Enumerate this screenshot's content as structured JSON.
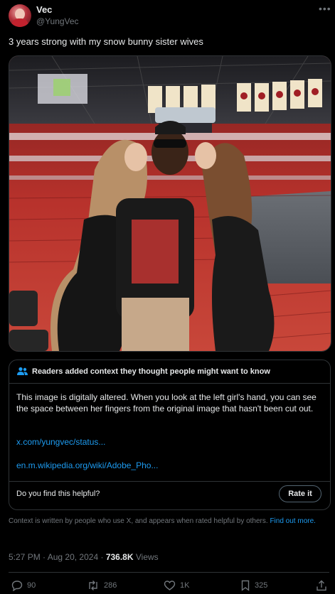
{
  "author": {
    "name": "Vec",
    "handle": "@YungVec",
    "more_glyph": "•••"
  },
  "tweet": {
    "text": "3 years strong with my snow bunny sister wives"
  },
  "community_note": {
    "title": "Readers added context they thought people might want to know",
    "body": "This image is digitally altered. When you look at the left girl's hand, you can see the space between her fingers from the original image that hasn't been cut out.",
    "links": [
      "x.com/yungvec/status...",
      "en.m.wikipedia.org/wiki/Adobe_Pho..."
    ],
    "helpful_question": "Do you find this helpful?",
    "rate_label": "Rate it"
  },
  "disclaimer": {
    "text": "Context is written by people who use X, and appears when rated helpful by others.",
    "link": "Find out more."
  },
  "meta": {
    "time": "5:27 PM",
    "date": "Aug 20, 2024",
    "views_count": "736.8K",
    "views_label": "Views",
    "sep": "·"
  },
  "actions": {
    "replies": "90",
    "reposts": "286",
    "likes": "1K",
    "bookmarks": "325"
  },
  "colors": {
    "background": "#000000",
    "text": "#e7e9ea",
    "muted": "#71767b",
    "link": "#1d9bf0",
    "border": "#2f3336"
  }
}
